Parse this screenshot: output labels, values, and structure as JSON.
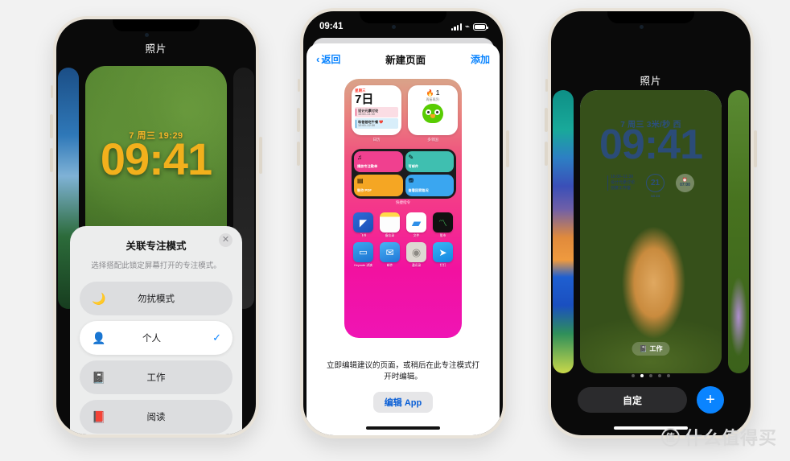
{
  "phone1": {
    "screen_title": "照片",
    "lock": {
      "date": "7 周三  19:29",
      "time": "09:41"
    },
    "sheet": {
      "title": "关联专注模式",
      "close_icon": "close-icon",
      "subtitle": "选择搭配此锁定屏幕打开的专注模式。",
      "options": [
        {
          "icon": "moon-icon",
          "glyph": "🌙",
          "label": "勿扰模式",
          "selected": false
        },
        {
          "icon": "person-icon",
          "glyph": "👤",
          "label": "个人",
          "selected": true,
          "check": "✓"
        },
        {
          "icon": "briefcase-icon",
          "glyph": "💼",
          "label": "工作",
          "selected": false
        },
        {
          "icon": "book-icon",
          "glyph": "📕",
          "label": "阅读",
          "selected": false
        }
      ]
    }
  },
  "phone2": {
    "status": {
      "time": "09:41",
      "signal_icon": "cellular-bars-icon",
      "wifi_icon": "wifi-icon",
      "battery_icon": "battery-icon"
    },
    "nav": {
      "back_icon": "chevron-left-icon",
      "back": "返回",
      "title": "新建页面",
      "action": "添加"
    },
    "home": {
      "calendar_widget": {
        "weekday": "星期三",
        "day": "7日",
        "label": "日历",
        "events": [
          {
            "title": "设计元素讨论",
            "time": "10:00–11:30"
          },
          {
            "title": "和爸爸吃午餐 ❤️",
            "time": "12:00–12:30"
          }
        ]
      },
      "duolingo_widget": {
        "streak_icon": "flame-icon",
        "streak": "1",
        "message": "再接再厉!",
        "label": "多邻国"
      },
      "shortcuts_widget": {
        "label": "快捷指令",
        "items": [
          {
            "icon": "music-note-icon",
            "glyph": "♫",
            "label": "播放专注歌单"
          },
          {
            "icon": "compose-icon",
            "glyph": "✎",
            "label": "写邮件"
          },
          {
            "icon": "document-icon",
            "glyph": "▤",
            "label": "制作 PDF"
          },
          {
            "icon": "car-icon",
            "glyph": "⛃",
            "label": "查看回家路况"
          }
        ]
      },
      "apps": [
        {
          "name": "飞书",
          "icon": "feishu-icon"
        },
        {
          "name": "备忘录",
          "icon": "notes-icon"
        },
        {
          "name": "文件",
          "icon": "files-icon"
        },
        {
          "name": "股市",
          "icon": "stocks-icon"
        },
        {
          "name": "Keynote 讲演",
          "icon": "keynote-icon"
        },
        {
          "name": "邮件",
          "icon": "mail-icon"
        },
        {
          "name": "通讯录",
          "icon": "contacts-icon"
        },
        {
          "name": "钉钉",
          "icon": "dingtalk-icon"
        }
      ]
    },
    "footer": {
      "note": "立即编辑建议的页面，或稍后在此专注模式打开时编辑。",
      "button": "编辑 App"
    }
  },
  "phone3": {
    "screen_title": "照片",
    "lock": {
      "date": "7 周三  3米/秒 西",
      "time": "09:41",
      "widgets": {
        "event": {
          "time": "10:00–11:30",
          "title": "设计元素讨论",
          "place": "创意工作室"
        },
        "ring": {
          "value": "21",
          "sub": "14  24"
        },
        "alarm": {
          "icon": "alarm-icon",
          "time": "07:00"
        }
      },
      "focus_badge": {
        "icon": "briefcase-icon",
        "label": "工作"
      }
    },
    "page_dots": {
      "count": 5,
      "active_index": 1
    },
    "customize_button": "自定",
    "add_button_icon": "plus-icon"
  },
  "watermark": {
    "badge": "值",
    "text": "什么值得买"
  },
  "colors": {
    "ios_blue": "#0a84ff",
    "focus_check": "#0a84ff",
    "clock_yellow": "#f2b01c",
    "clock_blue": "#2b4c78"
  }
}
